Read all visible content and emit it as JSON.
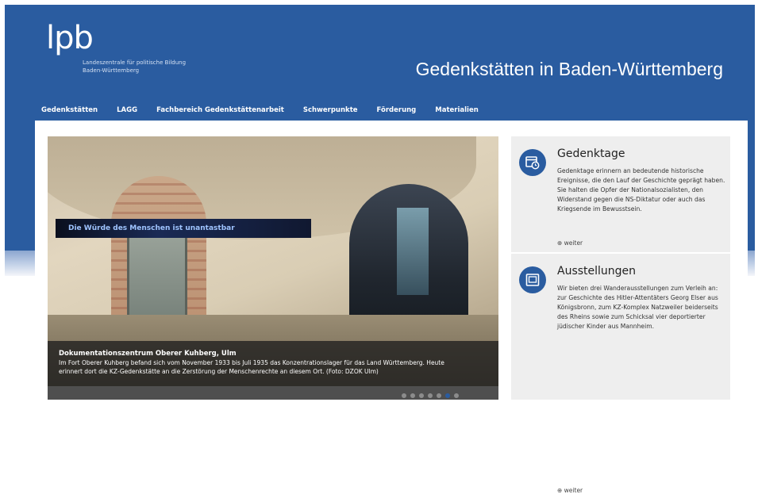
{
  "logo": {
    "text": "lpb",
    "sub_line1": "Landeszentrale für politische Bildung",
    "sub_line2": "Baden-Württemberg"
  },
  "site_title": "Gedenkstätten in Baden-Württemberg",
  "nav": [
    "Gedenkstätten",
    "LAGG",
    "Fachbereich Gedenkstättenarbeit",
    "Schwerpunkte",
    "Förderung",
    "Materialien"
  ],
  "slider": {
    "banner_text": "Die Würde des Menschen ist unantastbar",
    "caption_title": "Dokumentationszentrum Oberer Kuhberg, Ulm",
    "caption_text": "Im Fort Oberer Kuhberg befand sich vom November 1933 bis Juli 1935 das Konzentrationslager für das Land Württemberg. Heute erinnert dort die KZ-Gedenkstätte an die Zerstörung der Menschenrechte an diesem Ort. (Foto: DZOK Ulm)",
    "dot_count": 7,
    "active_index": 5
  },
  "sidebar": {
    "gedenktage": {
      "title": "Gedenktage",
      "text": "Gedenktage erinnern an bedeutende historische Ereignisse, die den Lauf der Geschichte geprägt haben. Sie halten die Opfer der Nationalsozialisten, den Widerstand gegen die NS-Diktatur oder auch das Kriegsende im Bewusstsein.",
      "more": "weiter",
      "icon": "calendar-clock-icon"
    },
    "ausstellungen": {
      "title": "Ausstellungen",
      "text": "Wir bieten drei Wanderausstellungen zum Verleih an: zur Geschichte des Hitler-Attentäters Georg Elser aus Königsbronn, zum KZ-Komplex Natzweiler beiderseits des Rheins sowie zum Schicksal vier deportierter jüdischer Kinder aus Mannheim.",
      "more": "weiter",
      "icon": "exhibition-icon"
    }
  },
  "colors": {
    "brand_blue": "#2a5ca0",
    "sidebar_bg": "#eeeeee"
  }
}
